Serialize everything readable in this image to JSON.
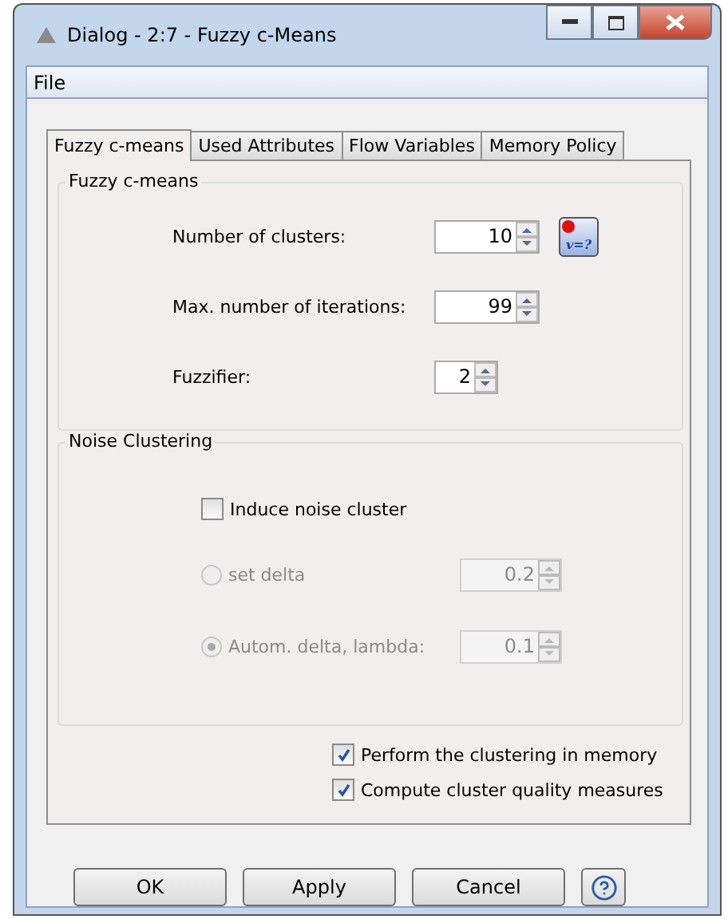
{
  "window": {
    "title": "Dialog - 2:7 - Fuzzy c-Means"
  },
  "menu": [
    "File"
  ],
  "tabs": [
    {
      "label": "Fuzzy c-means",
      "selected": true
    },
    {
      "label": "Used Attributes",
      "selected": false
    },
    {
      "label": "Flow Variables",
      "selected": false
    },
    {
      "label": "Memory Policy",
      "selected": false
    }
  ],
  "fuzzy_group": {
    "title": "Fuzzy c-means",
    "fields": [
      {
        "label": "Number of clusters:",
        "value": "10",
        "flow_variable": "v=?"
      },
      {
        "label": "Max. number of iterations:",
        "value": "99"
      },
      {
        "label": "Fuzzifier:",
        "value": "2"
      }
    ]
  },
  "noise_group": {
    "title": "Noise Clustering",
    "induce": {
      "label": "Induce noise cluster",
      "checked": false
    },
    "options": [
      {
        "label": "set delta",
        "selected": false,
        "disabled": true,
        "value": "0.2"
      },
      {
        "label": "Autom. delta, lambda:",
        "selected": true,
        "disabled": true,
        "value": "0.1"
      }
    ]
  },
  "checkboxes": [
    {
      "label": "Perform the clustering in memory",
      "checked": true
    },
    {
      "label": "Compute cluster quality measures",
      "checked": true
    }
  ],
  "buttons": [
    "OK",
    "Apply",
    "Cancel"
  ]
}
